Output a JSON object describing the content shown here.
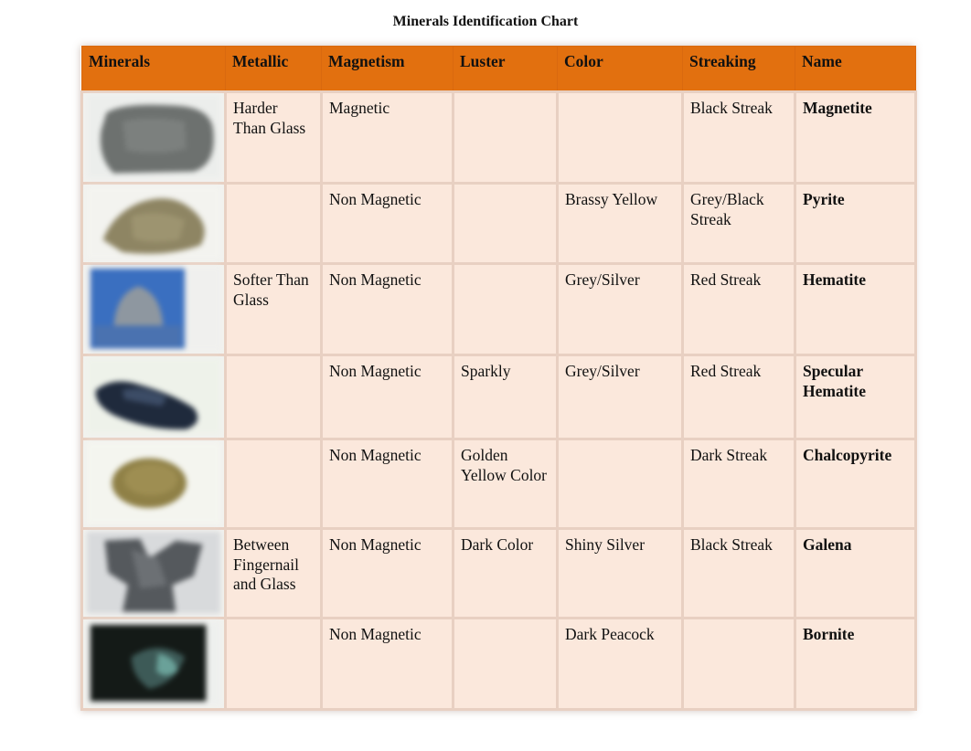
{
  "title": "Minerals Identification Chart",
  "headers": {
    "minerals": "Minerals",
    "metallic": "Metallic",
    "magnetism": "Magnetism",
    "luster": "Luster",
    "color": "Color",
    "streaking": "Streaking",
    "name": "Name"
  },
  "colors": {
    "header_bg": "#e2700f",
    "cell_bg": "#fbe8dc"
  },
  "rows": [
    {
      "image": "magnetite-photo",
      "metallic": "Harder Than Glass",
      "magnetism": "Magnetic",
      "luster": "",
      "color": "",
      "streaking": "Black Streak",
      "name": "Magnetite"
    },
    {
      "image": "pyrite-photo",
      "metallic": "",
      "magnetism": "Non Magnetic",
      "luster": "",
      "color": "Brassy Yellow",
      "streaking": "Grey/Black Streak",
      "name": "Pyrite"
    },
    {
      "image": "hematite-photo",
      "metallic": "Softer Than Glass",
      "magnetism": "Non Magnetic",
      "luster": "",
      "color": "Grey/Silver",
      "streaking": "Red Streak",
      "name": "Hematite"
    },
    {
      "image": "specular-hematite-photo",
      "metallic": "",
      "magnetism": "Non Magnetic",
      "luster": "Sparkly",
      "color": "Grey/Silver",
      "streaking": "Red Streak",
      "name": "Specular Hematite"
    },
    {
      "image": "chalcopyrite-photo",
      "metallic": "",
      "magnetism": "Non Magnetic",
      "luster": "Golden Yellow Color",
      "color": "",
      "streaking": "Dark Streak",
      "name": "Chalcopyrite"
    },
    {
      "image": "galena-photo",
      "metallic": "Between Fingernail and Glass",
      "magnetism": "Non Magnetic",
      "luster": "Dark Color",
      "color": "Shiny Silver",
      "streaking": "Black Streak",
      "name": "Galena"
    },
    {
      "image": "bornite-photo",
      "metallic": "",
      "magnetism": "Non Magnetic",
      "luster": "",
      "color": "Dark Peacock",
      "streaking": "",
      "name": "Bornite"
    }
  ]
}
